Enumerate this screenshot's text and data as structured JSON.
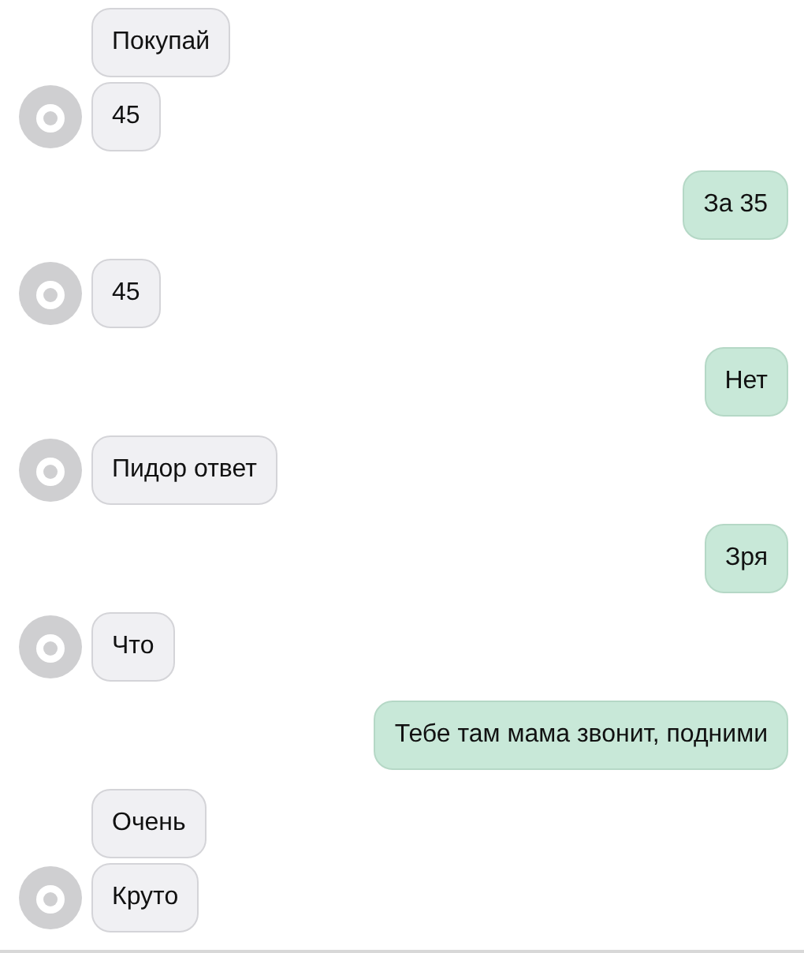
{
  "groups": [
    {
      "kind": "incoming",
      "texts": [
        "Покупай",
        "45"
      ]
    },
    {
      "kind": "outgoing",
      "texts": [
        "За 35"
      ]
    },
    {
      "kind": "incoming",
      "texts": [
        "45"
      ]
    },
    {
      "kind": "outgoing",
      "texts": [
        "Нет"
      ]
    },
    {
      "kind": "incoming",
      "texts": [
        "Пидор ответ"
      ]
    },
    {
      "kind": "outgoing",
      "texts": [
        "Зря"
      ]
    },
    {
      "kind": "incoming",
      "texts": [
        "Что"
      ]
    },
    {
      "kind": "outgoing",
      "texts": [
        "Тебе там мама звонит, подними"
      ]
    },
    {
      "kind": "incoming",
      "texts": [
        "Очень",
        "Круто"
      ]
    }
  ]
}
